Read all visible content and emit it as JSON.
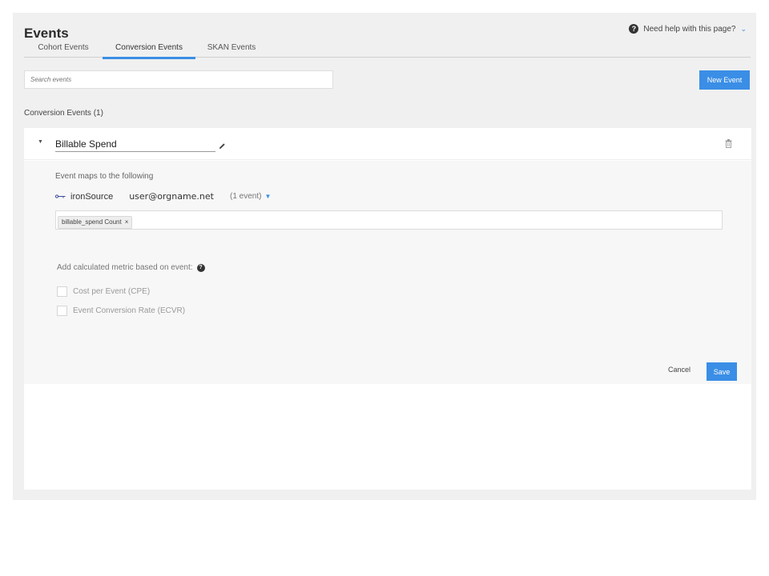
{
  "page": {
    "title": "Events",
    "help_text": "Need help with this page?"
  },
  "tabs": [
    {
      "label": "Cohort Events",
      "active": false
    },
    {
      "label": "Conversion Events",
      "active": true
    },
    {
      "label": "SKAN Events",
      "active": false
    }
  ],
  "search": {
    "placeholder": "Search events",
    "value": ""
  },
  "toolbar": {
    "new_event_label": "New Event"
  },
  "section": {
    "title": "Conversion Events (1)"
  },
  "event": {
    "name": "Billable Spend",
    "maps_label": "Event maps to the following",
    "source": {
      "name": "ironSource",
      "user": "user@orgname.net",
      "count": "(1 event)"
    },
    "tags": [
      {
        "label": "billable_spend Count"
      }
    ],
    "tag_remove": "×",
    "metric_label": "Add calculated metric based on event:",
    "metrics": [
      {
        "label": "Cost per Event (CPE)",
        "checked": false
      },
      {
        "label": "Event Conversion Rate (ECVR)",
        "checked": false
      }
    ],
    "cancel_label": "Cancel",
    "save_label": "Save"
  },
  "colors": {
    "accent": "#3a8ee6",
    "background": "#f0f0f0",
    "card": "#ffffff",
    "card_body": "#f7f7f7"
  },
  "icons": [
    "help-icon",
    "chevron-down-icon",
    "caret-down-icon",
    "pencil-icon",
    "trash-icon",
    "key-icon",
    "question-icon"
  ]
}
